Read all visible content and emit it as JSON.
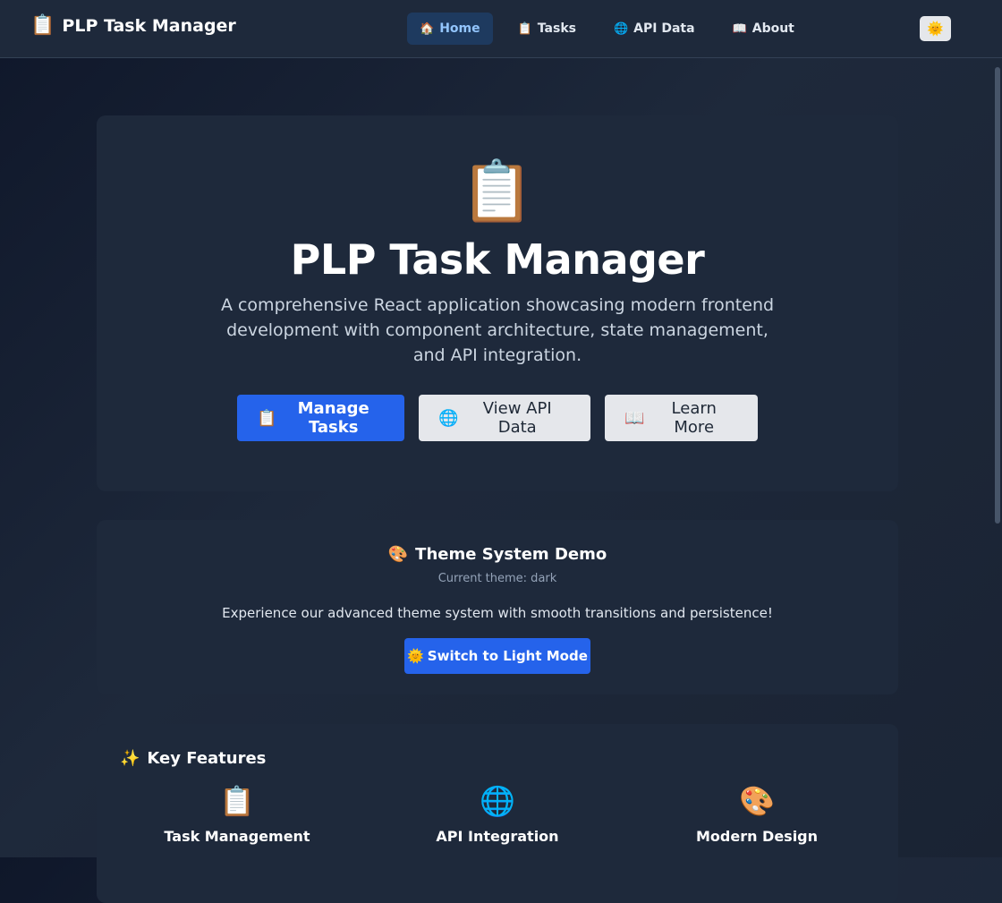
{
  "nav": {
    "brand_icon": "📋",
    "brand": "PLP Task Manager",
    "links": [
      {
        "icon": "🏠",
        "label": "Home",
        "active": true
      },
      {
        "icon": "📋",
        "label": "Tasks",
        "active": false
      },
      {
        "icon": "🌐",
        "label": "API Data",
        "active": false
      },
      {
        "icon": "📖",
        "label": "About",
        "active": false
      }
    ],
    "theme_toggle_icon": "🌞"
  },
  "hero": {
    "icon": "📋",
    "title": "PLP Task Manager",
    "description": "A comprehensive React application showcasing modern frontend development with component architecture, state management, and API integration.",
    "buttons": [
      {
        "icon": "📋",
        "label": "Manage Tasks"
      },
      {
        "icon": "🌐",
        "label": "View API Data"
      },
      {
        "icon": "📖",
        "label": "Learn More"
      }
    ]
  },
  "theme_demo": {
    "icon": "🎨",
    "title": "Theme System Demo",
    "current": "Current theme: dark",
    "description": "Experience our advanced theme system with smooth transitions and persistence!",
    "switch_icon": "🌞",
    "switch_label": "Switch to Light Mode"
  },
  "features": {
    "icon": "✨",
    "title": "Key Features",
    "items": [
      {
        "icon": "📋",
        "label": "Task Management"
      },
      {
        "icon": "🌐",
        "label": "API Integration"
      },
      {
        "icon": "🎨",
        "label": "Modern Design"
      }
    ]
  },
  "colors": {
    "accent": "#2563eb",
    "background": "#0f172a",
    "card": "#1e293b"
  }
}
